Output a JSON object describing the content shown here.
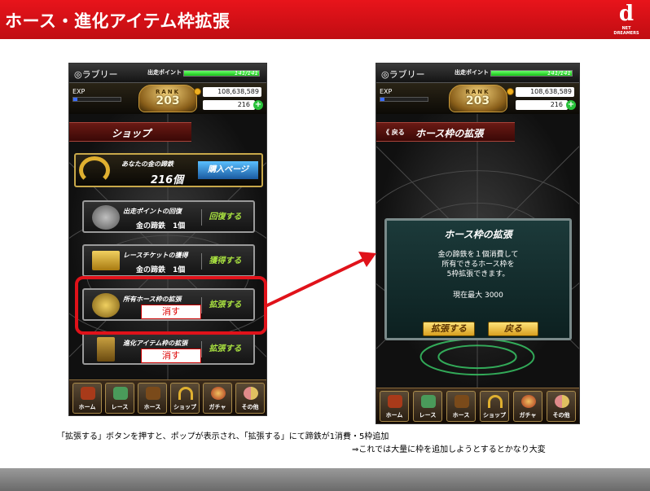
{
  "header": {
    "title": "ホース・進化アイテム枠拡張",
    "logo_mark": "d",
    "logo_text": "NET DREAMERS",
    "color": "#e0121a"
  },
  "left_phone": {
    "player": "◎ラブリー",
    "sp_label": "出走ポイント",
    "sp_value": "141/141",
    "sp_fraction": 1.0,
    "exp_label": "EXP",
    "exp_fraction": 0.08,
    "rank_label": "RANK",
    "rank_value": "203",
    "money": "108,638,589",
    "shoes": "216",
    "plus": "+",
    "screen_title": "ショップ",
    "horseshoe_title": "あなたの金の蹄鉄",
    "horseshoe_count": "216個",
    "buy_button": "購入ページ",
    "items": [
      {
        "title": "出走ポイントの回復",
        "cost": "金の蹄鉄　1個",
        "button": "回復する"
      },
      {
        "title": "レースチケットの獲得",
        "cost": "金の蹄鉄　1個",
        "button": "獲得する"
      },
      {
        "title": "所有ホース枠の拡張",
        "struck": "消す",
        "button": "拡張する"
      },
      {
        "title": "進化アイテム枠の拡張",
        "struck": "消す",
        "button": "拡張する"
      }
    ],
    "nav": [
      "ホーム",
      "レース",
      "ホース",
      "ショップ",
      "ガチャ",
      "その他"
    ]
  },
  "right_phone": {
    "player": "◎ラブリー",
    "sp_label": "出走ポイント",
    "sp_value": "141/141",
    "exp_label": "EXP",
    "rank_label": "RANK",
    "rank_value": "203",
    "money": "108,638,589",
    "shoes": "216",
    "plus": "+",
    "back_label": "《 戻る",
    "screen_title": "ホース枠の拡張",
    "popup": {
      "title": "ホース枠の拡張",
      "lines": [
        "金の蹄鉄を１個消費して",
        "所有できるホース枠を",
        "5枠拡張できます。"
      ],
      "max": "現在最大 3000",
      "confirm": "拡張する",
      "cancel": "戻る"
    },
    "nav": [
      "ホーム",
      "レース",
      "ホース",
      "ショップ",
      "ガチャ",
      "その他"
    ]
  },
  "captions": {
    "line1": "「拡張する」ボタンを押すと、ポップが表示され、「拡張する」にて蹄鉄が1消費・5枠追加",
    "line2": "⇒これでは大量に枠を追加しようとするとかなり大変"
  },
  "highlight_color": "#e0121a"
}
